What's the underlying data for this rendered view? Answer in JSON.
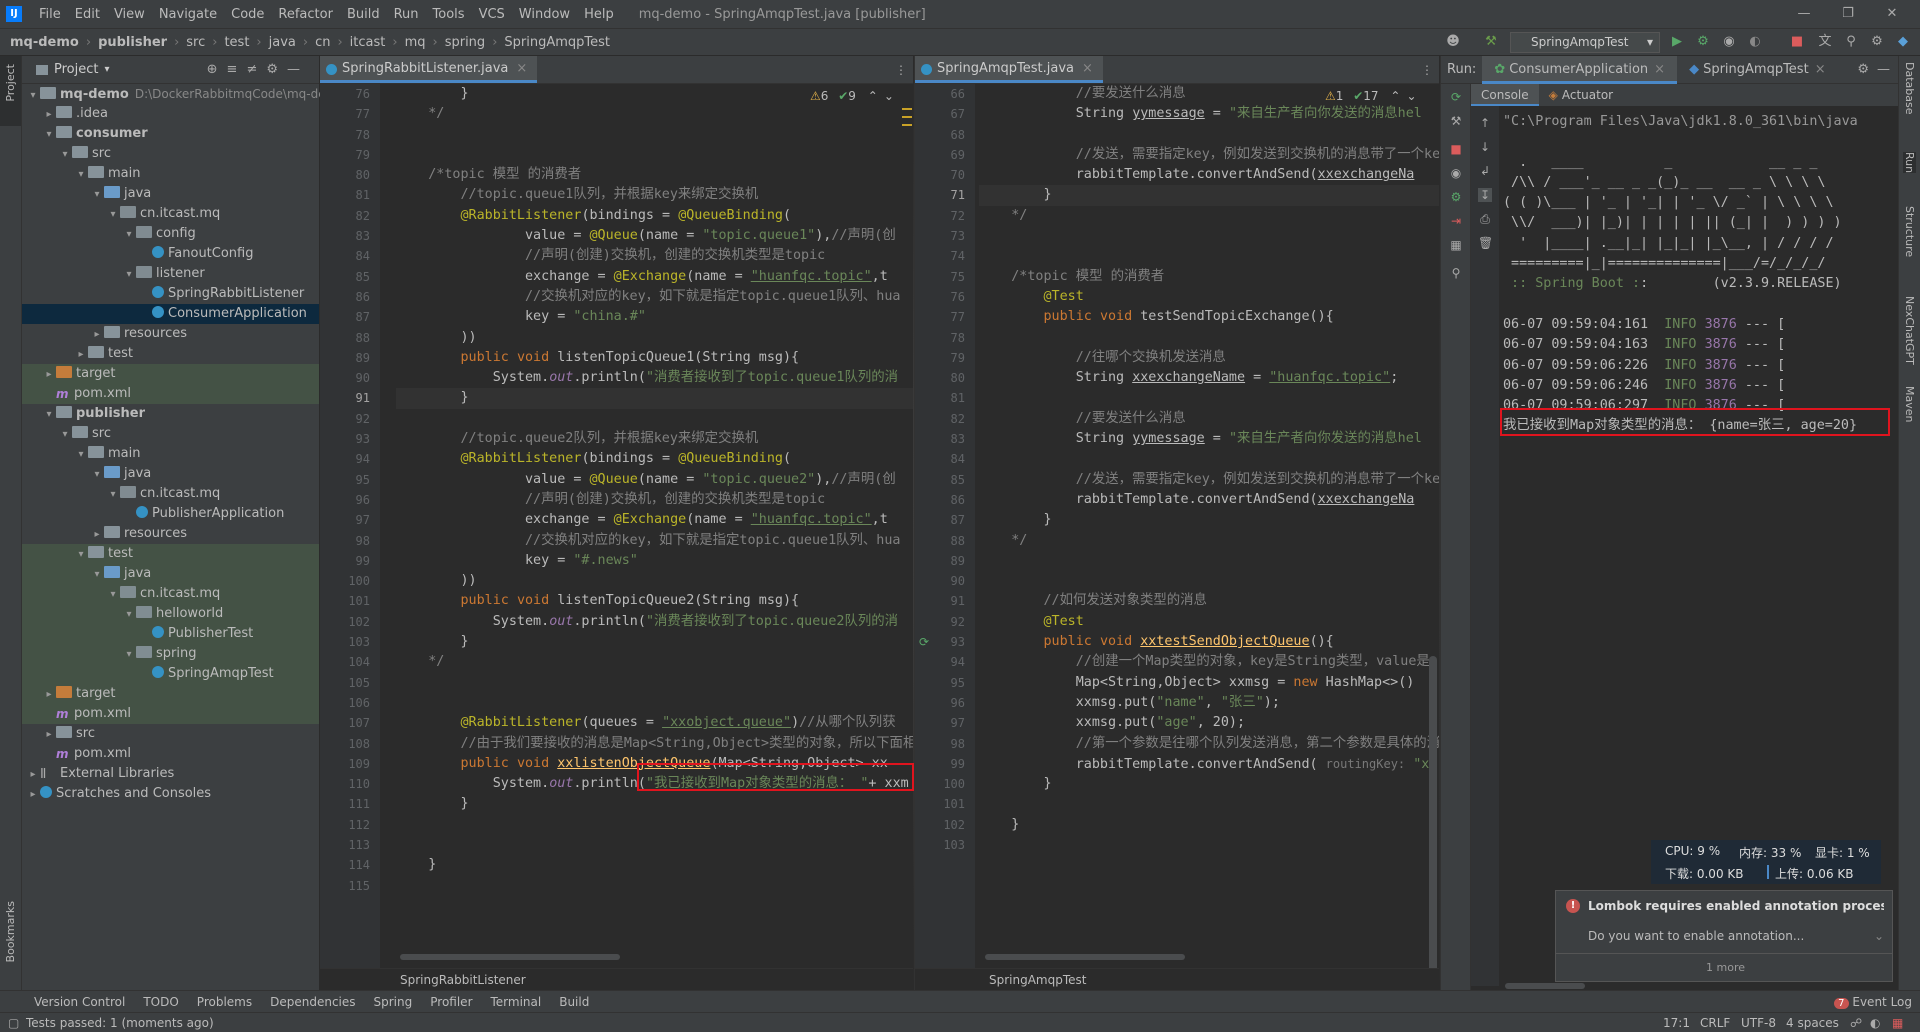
{
  "menu": {
    "items": [
      "File",
      "Edit",
      "View",
      "Navigate",
      "Code",
      "Refactor",
      "Build",
      "Run",
      "Tools",
      "VCS",
      "Window",
      "Help"
    ],
    "window_title": "mq-demo - SpringAmqpTest.java [publisher]"
  },
  "breadcrumb": [
    "mq-demo",
    "publisher",
    "src",
    "test",
    "java",
    "cn",
    "itcast",
    "mq",
    "spring",
    "SpringAmqpTest"
  ],
  "run_config": "SpringAmqpTest",
  "project": {
    "header": "Project",
    "tree": [
      {
        "label": "mq-demo",
        "extra": "D:\\DockerRabbitmqCode\\mq-de",
        "icon": "folder"
      },
      {
        "label": ".idea",
        "icon": "folder"
      },
      {
        "label": "consumer",
        "icon": "folder"
      },
      {
        "label": "src",
        "icon": "folder"
      },
      {
        "label": "main",
        "icon": "folder"
      },
      {
        "label": "java",
        "icon": "folder-blue"
      },
      {
        "label": "cn.itcast.mq",
        "icon": "package"
      },
      {
        "label": "config",
        "icon": "package"
      },
      {
        "label": "FanoutConfig",
        "icon": "class"
      },
      {
        "label": "listener",
        "icon": "package"
      },
      {
        "label": "SpringRabbitListener",
        "icon": "class"
      },
      {
        "label": "ConsumerApplication",
        "icon": "class"
      },
      {
        "label": "resources",
        "icon": "folder"
      },
      {
        "label": "test",
        "icon": "folder"
      },
      {
        "label": "target",
        "icon": "folder-orange"
      },
      {
        "label": "pom.xml",
        "icon": "maven"
      },
      {
        "label": "publisher",
        "icon": "folder"
      },
      {
        "label": "src",
        "icon": "folder"
      },
      {
        "label": "main",
        "icon": "folder"
      },
      {
        "label": "java",
        "icon": "folder-blue"
      },
      {
        "label": "cn.itcast.mq",
        "icon": "package"
      },
      {
        "label": "PublisherApplication",
        "icon": "class"
      },
      {
        "label": "resources",
        "icon": "folder"
      },
      {
        "label": "test",
        "icon": "folder"
      },
      {
        "label": "java",
        "icon": "folder-blue"
      },
      {
        "label": "cn.itcast.mq",
        "icon": "package"
      },
      {
        "label": "helloworld",
        "icon": "package"
      },
      {
        "label": "PublisherTest",
        "icon": "class"
      },
      {
        "label": "spring",
        "icon": "package"
      },
      {
        "label": "SpringAmqpTest",
        "icon": "class"
      },
      {
        "label": "target",
        "icon": "folder-orange"
      },
      {
        "label": "pom.xml",
        "icon": "maven"
      },
      {
        "label": "src",
        "icon": "folder"
      },
      {
        "label": "pom.xml",
        "icon": "maven"
      },
      {
        "label": "External Libraries",
        "icon": "library"
      },
      {
        "label": "Scratches and Consoles",
        "icon": "scratch"
      }
    ]
  },
  "editor_left": {
    "tab": "SpringRabbitListener.java",
    "footer": "SpringRabbitListener",
    "inspections": {
      "warnings": "6",
      "ok": "9"
    },
    "line_numbers": [
      "76",
      "77",
      "78",
      "79",
      "80",
      "81",
      "82",
      "83",
      "84",
      "85",
      "86",
      "87",
      "88",
      "89",
      "90",
      "91",
      "92",
      "93",
      "94",
      "95",
      "96",
      "97",
      "98",
      "99",
      "100",
      "101",
      "102",
      "103",
      "104",
      "105",
      "106",
      "107",
      "108",
      "109",
      "110",
      "111",
      "112",
      "113",
      "114",
      "115"
    ],
    "lines": [
      "        }",
      "    */",
      "",
      "",
      "    /*topic 模型 的消费者",
      "        //topic.queue1队列，并根据key来绑定交换机",
      "        @RabbitListener(bindings = @QueueBinding(",
      "                value = @Queue(name = \"topic.queue1\"),//声明(创",
      "                //声明(创建)交换机，创建的交换机类型是topic",
      "                exchange = @Exchange(name = \"huanfqc.topic\",t",
      "                //交换机对应的key，如下就是指定topic.queue1队列、hua",
      "                key = \"china.#\"",
      "        ))",
      "        public void listenTopicQueue1(String msg){",
      "            System.out.println(\"消费者接收到了topic.queue1队列的消",
      "        }",
      "",
      "        //topic.queue2队列，并根据key来绑定交换机",
      "        @RabbitListener(bindings = @QueueBinding(",
      "                value = @Queue(name = \"topic.queue2\"),//声明(创",
      "                //声明(创建)交换机，创建的交换机类型是topic",
      "                exchange = @Exchange(name = \"huanfqc.topic\",t",
      "                //交换机对应的key，如下就是指定topic.queue1队列、hua",
      "                key = \"#.news\"",
      "        ))",
      "        public void listenTopicQueue2(String msg){",
      "            System.out.println(\"消费者接收到了topic.queue2队列的消",
      "        }",
      "    */",
      "",
      "",
      "        @RabbitListener(queues = \"xxobject.queue\")//从哪个队列获",
      "        //由于我们要接收的消息是Map<String,Object>类型的对象，所以下面相",
      "        public void xxlistenObjectQueue(Map<String,Object> xx",
      "            System.out.println(\"我已接收到Map对象类型的消息： \"+ xxm",
      "        }",
      "",
      "",
      "    }",
      ""
    ]
  },
  "editor_right": {
    "tab": "SpringAmqpTest.java",
    "footer": "SpringAmqpTest",
    "inspections": {
      "warnings": "1",
      "ok": "17"
    },
    "line_numbers": [
      "66",
      "67",
      "68",
      "69",
      "70",
      "71",
      "72",
      "73",
      "74",
      "75",
      "76",
      "77",
      "78",
      "79",
      "80",
      "81",
      "82",
      "83",
      "84",
      "85",
      "86",
      "87",
      "88",
      "89",
      "90",
      "91",
      "92",
      "93",
      "94",
      "95",
      "96",
      "97",
      "98",
      "99",
      "100",
      "101",
      "102",
      "103"
    ],
    "lines": [
      "            //要发送什么消息",
      "            String yymessage = \"来自生产者向你发送的消息hel",
      "",
      "            //发送，需要指定key，例如发送到交换机的消息带了一个ke",
      "            rabbitTemplate.convertAndSend(xxexchangeNa",
      "        }",
      "    */",
      "",
      "",
      "    /*topic 模型 的消费者",
      "        @Test",
      "        public void testSendTopicExchange(){",
      "",
      "            //往哪个交换机发送消息",
      "            String xxexchangeName = \"huanfqc.topic\";",
      "",
      "            //要发送什么消息",
      "            String yymessage = \"来自生产者向你发送的消息hel",
      "",
      "            //发送，需要指定key，例如发送到交换机的消息带了一个ke",
      "            rabbitTemplate.convertAndSend(xxexchangeNa",
      "        }",
      "    */",
      "",
      "",
      "        //如何发送对象类型的消息",
      "        @Test",
      "        public void xxtestSendObjectQueue(){",
      "            //创建一个Map类型的对象，key是String类型，value是",
      "            Map<String,Object> xxmsg = new HashMap<>()",
      "            xxmsg.put(\"name\", \"张三\");",
      "            xxmsg.put(\"age\", 20);",
      "            //第一个参数是往哪个队列发送消息，第二个参数是具体的消",
      "            rabbitTemplate.convertAndSend( routingKey: \"xx",
      "        }",
      "",
      "    }",
      ""
    ]
  },
  "run": {
    "label": "Run:",
    "tabs": [
      "ConsumerApplication",
      "SpringAmqpTest"
    ],
    "subtabs": [
      "Console",
      "Actuator"
    ],
    "console": [
      "\"C:\\Program Files\\Java\\jdk1.8.0_361\\bin\\java",
      "",
      "  .   ____          _            __ _ _",
      " /\\\\ / ___'_ __ _ _(_)_ __  __ _ \\ \\ \\ \\",
      "( ( )\\___ | '_ | '_| | '_ \\/ _` | \\ \\ \\ \\",
      " \\\\/  ___)| |_)| | | | | || (_| |  ) ) ) )",
      "  '  |____| .__|_| |_|_| |_\\__, | / / / /",
      " =========|_|==============|___/=/_/_/_/",
      " :: Spring Boot ::        (v2.3.9.RELEASE)",
      "",
      "06-07 09:59:04:161  INFO 3876 --- [",
      "06-07 09:59:04:163  INFO 3876 --- [",
      "06-07 09:59:06:226  INFO 3876 --- [",
      "06-07 09:59:06:246  INFO 3876 --- [",
      "06-07 09:59:06:297  INFO 3876 --- [",
      "我已接收到Map对象类型的消息： {name=张三, age=20}"
    ]
  },
  "system_monitor": {
    "cpu": "CPU: 9 %",
    "mem": "内存: 33 %",
    "gpu": "显卡: 1 %",
    "down": "下载: 0.00 KB",
    "up": "上传: 0.06 KB"
  },
  "notification": {
    "title": "Lombok requires enabled annotation process",
    "body": "Do you want to enable annotation...",
    "more": "1 more"
  },
  "bottom_tools": [
    "Version Control",
    "TODO",
    "Problems",
    "Dependencies",
    "Spring",
    "Profiler",
    "Terminal",
    "Build"
  ],
  "event_log": {
    "count": "7",
    "label": "Event Log"
  },
  "status": {
    "message": "Tests passed: 1 (moments ago)",
    "position": "17:1",
    "line_sep": "CRLF",
    "encoding": "UTF-8",
    "indent": "4 spaces"
  },
  "right_strip": [
    "Database",
    "Run",
    "Structure",
    "NexChatGPT",
    "Maven"
  ],
  "left_strip": [
    "Project",
    "Bookmarks"
  ],
  "colors": {
    "accent": "#4a88c7",
    "highlight": "#e0141e",
    "info": "#6a8759",
    "keyword": "#cc7832",
    "string": "#6a8759",
    "annotation": "#bbb529",
    "method": "#ffc66d",
    "field": "#9876aa",
    "comment": "#808080"
  }
}
